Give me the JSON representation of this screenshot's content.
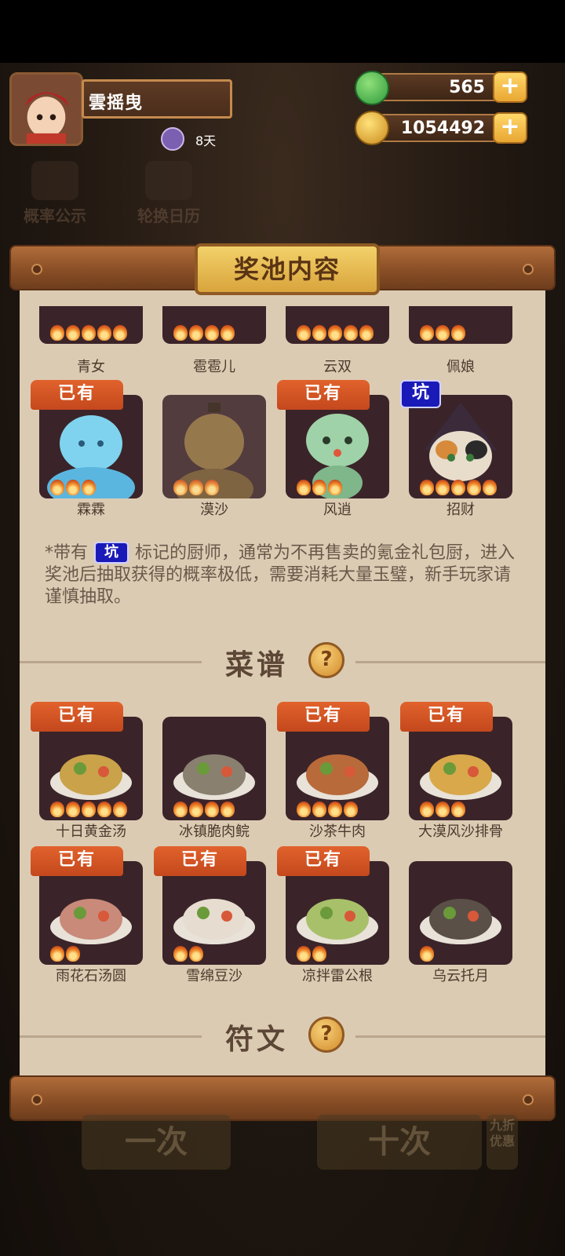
{
  "profile": {
    "name": "雲摇曳",
    "days": "8天"
  },
  "resources": {
    "jade": "565",
    "coins": "1054492"
  },
  "background_buttons": {
    "rates": "概率公示",
    "calendar": "轮换日历"
  },
  "panel": {
    "title": "奖池内容"
  },
  "badges": {
    "owned": "已有",
    "pit": "坑"
  },
  "chefs_partial": [
    {
      "name": "青女",
      "stars": 5
    },
    {
      "name": "雹雹儿",
      "stars": 4
    },
    {
      "name": "云双",
      "stars": 5
    },
    {
      "name": "佩娘",
      "stars": 3
    }
  ],
  "chefs": [
    {
      "name": "霖霖",
      "stars": 3,
      "owned": true,
      "pit": false,
      "color": "#7fd3ee"
    },
    {
      "name": "漠沙",
      "stars": 3,
      "owned": false,
      "pit": false,
      "color": "#8a6a3c"
    },
    {
      "name": "风逍",
      "stars": 3,
      "owned": true,
      "pit": false,
      "color": "#9fd2a8"
    },
    {
      "name": "招财",
      "stars": 5,
      "owned": false,
      "pit": true,
      "color": "#6b5a50"
    }
  ],
  "note": {
    "prefix": "*带有",
    "body": "标记的厨师，通常为不再售卖的氪金礼包厨，进入奖池后抽取获得的概率极低，需要消耗大量玉璧，新手玩家请谨慎抽取。"
  },
  "recipes_section": {
    "title": "菜谱",
    "help": "?"
  },
  "recipes": [
    {
      "name": "十日黄金汤",
      "stars": 5,
      "owned": true
    },
    {
      "name": "冰镇脆肉鲩",
      "stars": 4,
      "owned": false
    },
    {
      "name": "沙茶牛肉",
      "stars": 4,
      "owned": true
    },
    {
      "name": "大漠风沙排骨",
      "stars": 3,
      "owned": true
    },
    {
      "name": "雨花石汤圆",
      "stars": 2,
      "owned": true
    },
    {
      "name": "雪绵豆沙",
      "stars": 2,
      "owned": true
    },
    {
      "name": "凉拌雷公根",
      "stars": 2,
      "owned": true
    },
    {
      "name": "乌云托月",
      "stars": 1,
      "owned": false
    }
  ],
  "runes_section": {
    "title": "符文",
    "help": "?"
  },
  "bottom_buttons": {
    "single": "一次",
    "ten": "十次",
    "discount": "九折优惠"
  }
}
